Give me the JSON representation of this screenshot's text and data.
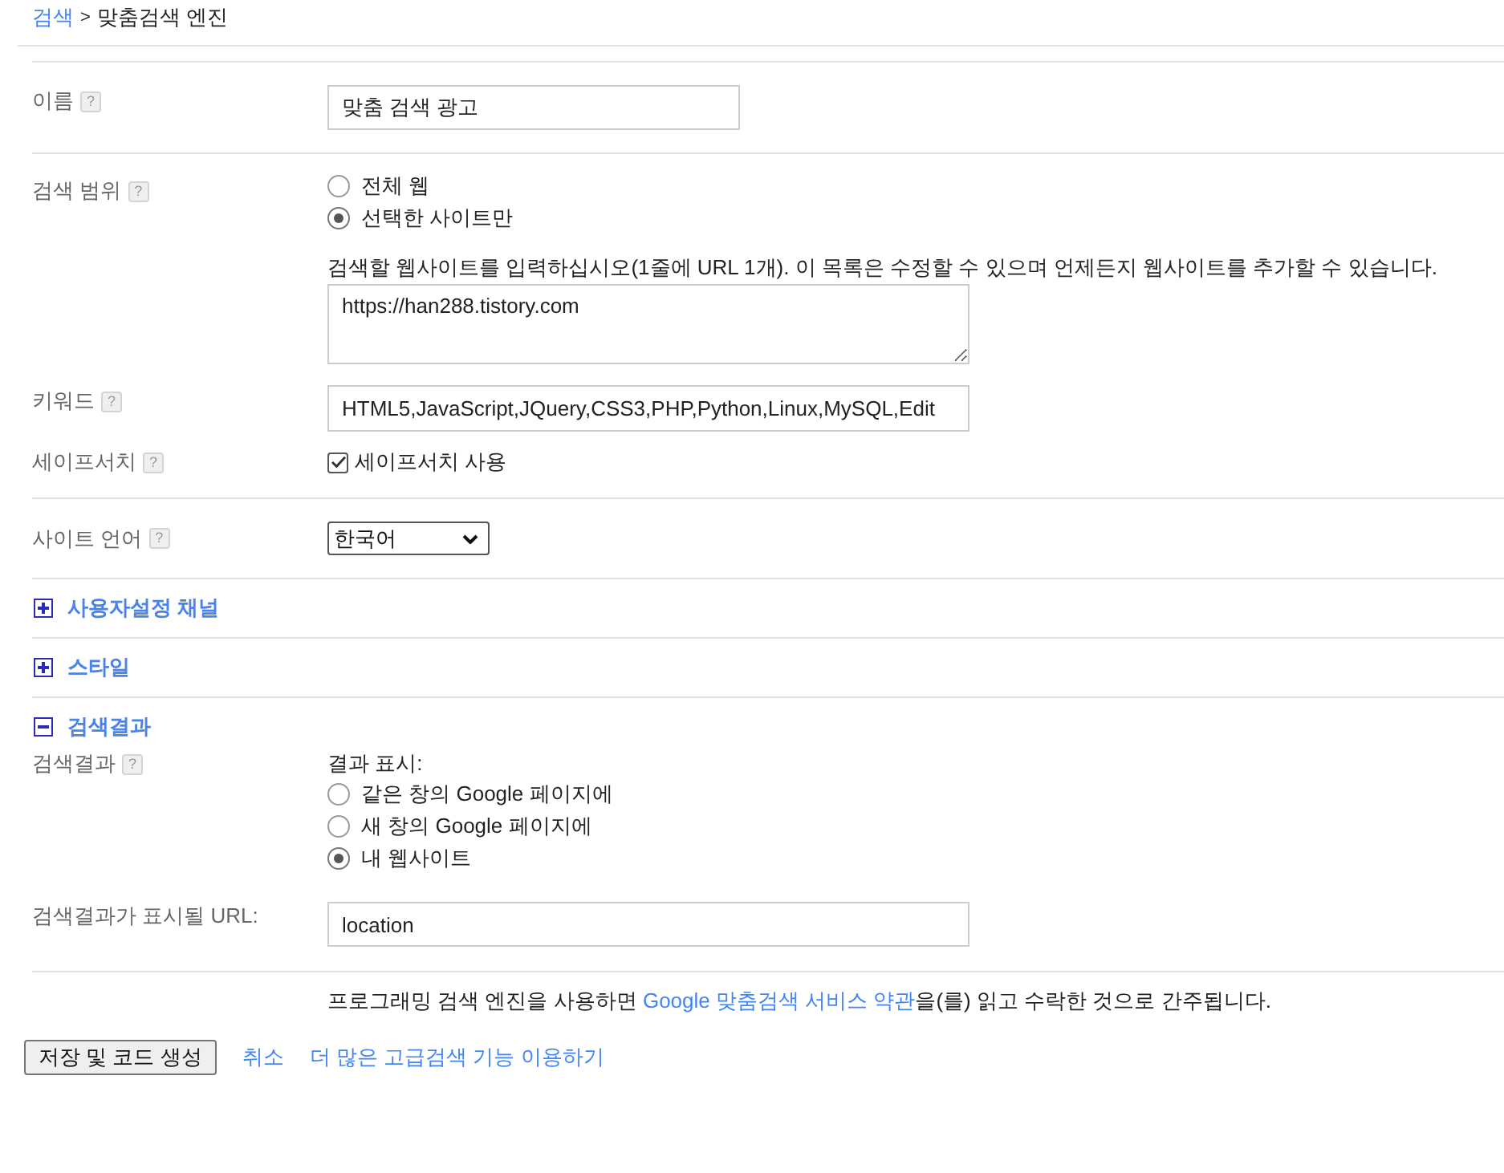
{
  "breadcrumb": {
    "link": "검색",
    "separator": ">",
    "current": "맞춤검색 엔진"
  },
  "name_row": {
    "label": "이름",
    "help": "?",
    "value": "맞춤 검색 광고"
  },
  "scope_row": {
    "label": "검색 범위",
    "help": "?",
    "options": [
      {
        "label": "전체 웹",
        "selected": false
      },
      {
        "label": "선택한 사이트만",
        "selected": true
      }
    ],
    "sites_hint": "검색할 웹사이트를 입력하십시오(1줄에 URL 1개). 이 목록은 수정할 수 있으며 언제든지 웹사이트를 추가할 수 있습니다.",
    "sites": "https://han288.tistory.com"
  },
  "keyword_row": {
    "label": "키워드",
    "help": "?",
    "value": "HTML5,JavaScript,JQuery,CSS3,PHP,Python,Linux,MySQL,Edit"
  },
  "safesearch_row": {
    "label": "세이프서치",
    "help": "?",
    "checkbox_label": "세이프서치 사용",
    "checked": true
  },
  "language_row": {
    "label": "사이트 언어",
    "help": "?",
    "value": "한국어"
  },
  "panels": [
    {
      "title": "사용자설정 채널",
      "expanded": false
    },
    {
      "title": "스타일",
      "expanded": false
    },
    {
      "title": "검색결과",
      "expanded": true,
      "display": {
        "label": "검색결과",
        "help": "?",
        "caption": "결과 표시:",
        "options": [
          {
            "label": "같은 창의 Google 페이지에",
            "selected": false
          },
          {
            "label": "새 창의 Google 페이지에",
            "selected": false
          },
          {
            "label": "내 웹사이트",
            "selected": true
          }
        ]
      },
      "url": {
        "label": "검색결과가 표시될 URL:",
        "value": "location"
      }
    }
  ],
  "notice": {
    "before": "프로그래밍 검색 엔진을 사용하면",
    "link": "Google 맞춤검색 서비스 약관",
    "after": "을(를) 읽고 수락한 것으로 간주됩니다."
  },
  "actions": {
    "save": "저장 및 코드 생성",
    "links": [
      "취소",
      "더 많은 고급검색 기능 이용하기"
    ]
  }
}
